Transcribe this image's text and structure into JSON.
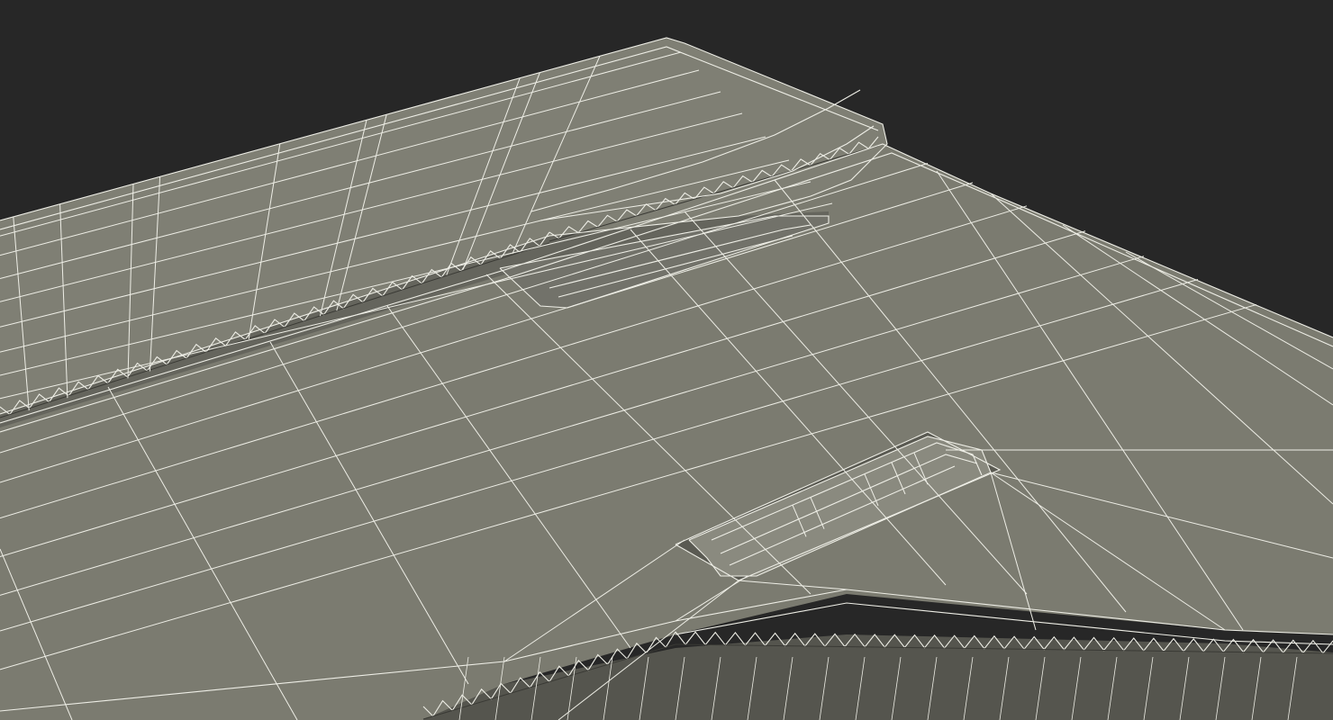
{
  "scene": {
    "subject": "wireframe-3d-render",
    "colors": {
      "background": "#272727",
      "surface": "#7b7b70",
      "surface_shade": "#6f6f65",
      "surface_dark": "#5d5d55",
      "cavity": "#4a4a44",
      "wire": "#eeeee6",
      "corrugation": "#3a3a35"
    }
  }
}
